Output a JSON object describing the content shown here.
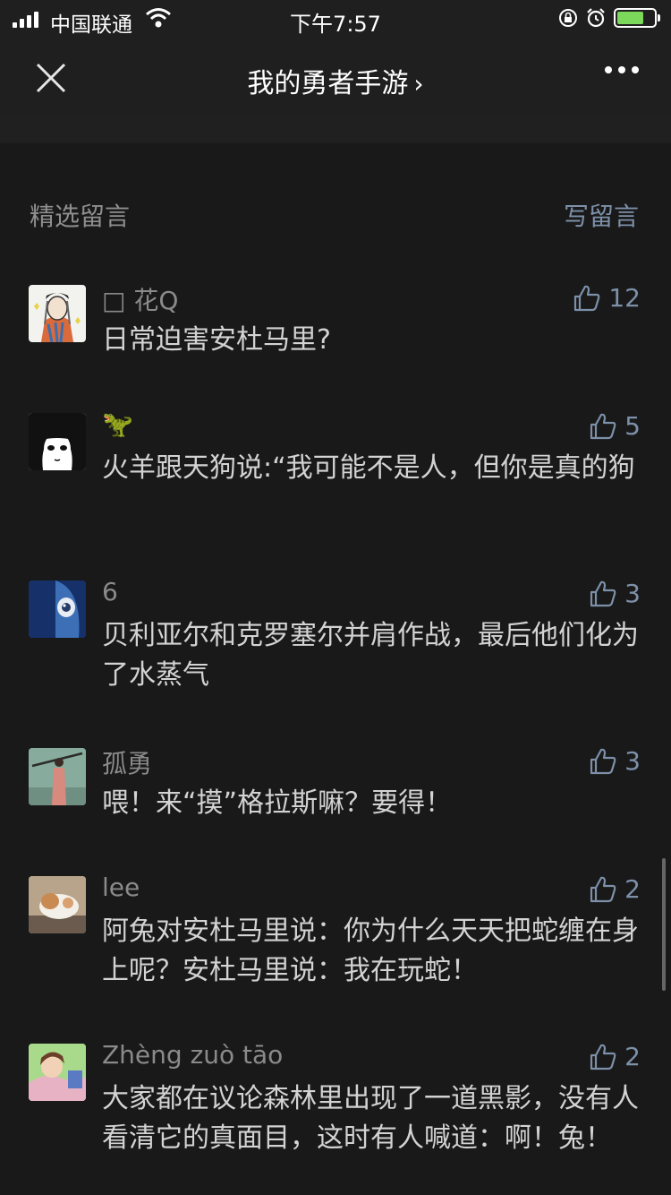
{
  "status_bar": {
    "carrier": "中国联通",
    "time": "下午7:57",
    "battery_level": 0.74
  },
  "nav": {
    "title": "我的勇者手游",
    "chevron": "›"
  },
  "section": {
    "title": "精选留言",
    "write_label": "写留言"
  },
  "comments": [
    {
      "name": "□ 花Q",
      "likes": "12",
      "text": "日常迫害安杜马里?"
    },
    {
      "name": "🦖",
      "likes": "5",
      "text": "火羊跟天狗说:“我可能不是人，但你是真的狗"
    },
    {
      "name": "6",
      "likes": "3",
      "text": "贝利亚尔和克罗塞尔并肩作战，最后他们化为了水蒸气"
    },
    {
      "name": "孤勇",
      "likes": "3",
      "text": "喂！来“摸”格拉斯嘛？要得！"
    },
    {
      "name": "lee",
      "likes": "2",
      "text": "阿兔对安杜马里说：你为什么天天把蛇缠在身上呢？安杜马里说：我在玩蛇！"
    },
    {
      "name": "Zhèng zuò tāo",
      "likes": "2",
      "text": "大家都在议论森林里出现了一道黑影，没有人看清它的真面目，这时有人喊道：啊！兔！"
    }
  ]
}
